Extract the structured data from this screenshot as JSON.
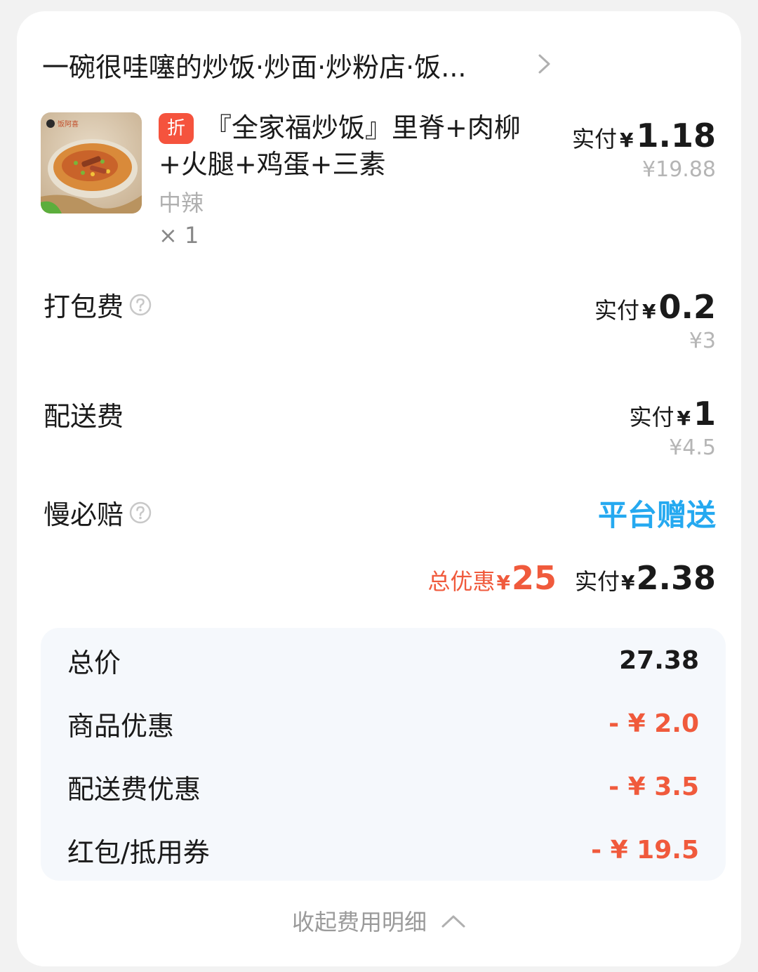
{
  "store": {
    "name": "一碗很哇噻的炒饭·炒面·炒粉店·饭..."
  },
  "item": {
    "badge": "折",
    "title": "『全家福炒饭』里脊+肉柳+火腿+鸡蛋+三素",
    "spec": "中辣",
    "quantity": "× 1",
    "paid_label": "实付",
    "currency": "¥",
    "paid_amount": "1.18",
    "original_price": "¥19.88",
    "thumb_logo": "饭阿喜"
  },
  "fees": [
    {
      "label": "打包费",
      "has_help": true,
      "paid_label": "实付",
      "currency": "¥",
      "paid_amount": "0.2",
      "original_price": "¥3"
    },
    {
      "label": "配送费",
      "has_help": false,
      "paid_label": "实付",
      "currency": "¥",
      "paid_amount": "1",
      "original_price": "¥4.5"
    }
  ],
  "slow_guarantee": {
    "label": "慢必赔",
    "value": "平台赠送"
  },
  "summary": {
    "discount_label": "总优惠",
    "discount_currency": "¥",
    "discount_amount": "25",
    "paid_label": "实付",
    "paid_currency": "¥",
    "paid_amount": "2.38"
  },
  "breakdown": [
    {
      "label": "总价",
      "value": "27.38"
    },
    {
      "label": "商品优惠",
      "value": "- ¥ 2.0"
    },
    {
      "label": "配送费优惠",
      "value": "- ¥ 3.5"
    },
    {
      "label": "红包/抵用券",
      "value": "- ¥ 19.5"
    }
  ],
  "collapse_label": "收起费用明细",
  "colors": {
    "accent_red": "#f05a3c",
    "accent_blue": "#25a9f0",
    "muted": "#b5b5b5"
  }
}
